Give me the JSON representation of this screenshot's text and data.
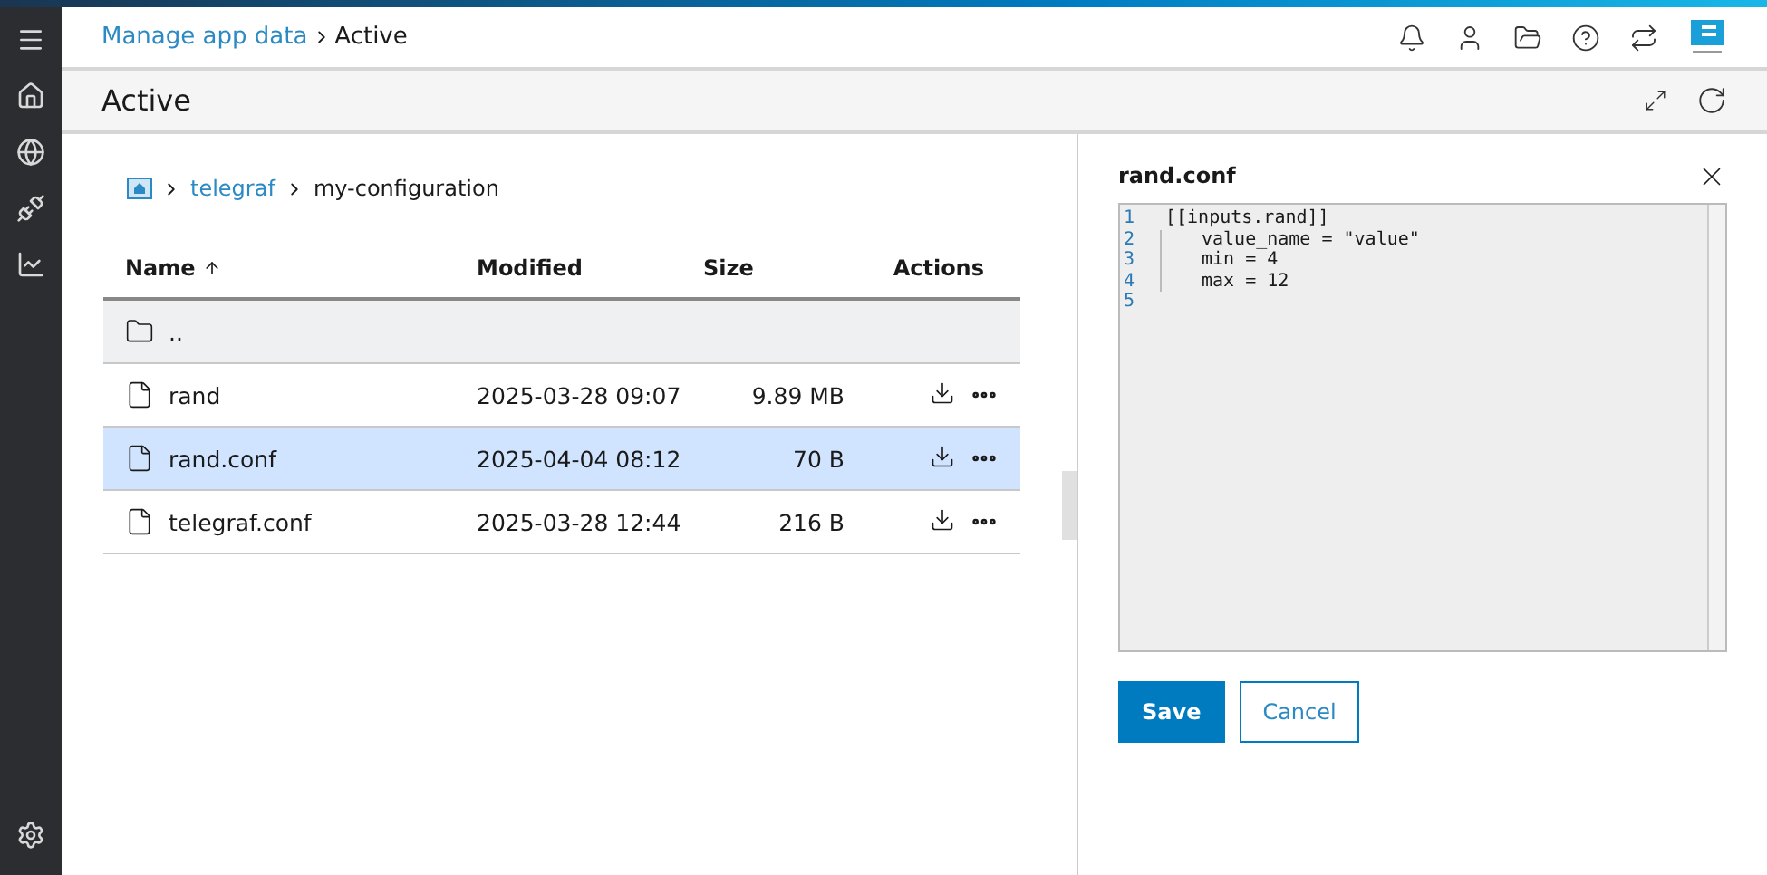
{
  "breadcrumb": [
    {
      "label": "Manage app data",
      "link": true
    },
    {
      "label": "Active",
      "link": false
    }
  ],
  "page_title": "Active",
  "path": [
    {
      "label": "telegraf",
      "link": true
    },
    {
      "label": "my-configuration",
      "link": false
    }
  ],
  "table": {
    "columns": [
      {
        "label": "Name",
        "sorted": true
      },
      {
        "label": "Modified",
        "sorted": false
      },
      {
        "label": "Size",
        "sorted": false
      },
      {
        "label": "Actions",
        "sorted": false
      }
    ],
    "rows": [
      {
        "kind": "parent",
        "name": "..",
        "selected": false
      },
      {
        "kind": "file",
        "name": "rand",
        "modified": "2025-03-28 09:07",
        "size": "9.89 MB",
        "selected": false
      },
      {
        "kind": "file",
        "name": "rand.conf",
        "modified": "2025-04-04 08:12",
        "size": "70 B",
        "selected": true
      },
      {
        "kind": "file",
        "name": "telegraf.conf",
        "modified": "2025-03-28 12:44",
        "size": "216 B",
        "selected": false
      }
    ]
  },
  "editor": {
    "title": "rand.conf",
    "lines": [
      {
        "number": "1",
        "text": "[[inputs.rand]]",
        "indented": false
      },
      {
        "number": "2",
        "text": "value_name = \"value\"",
        "indented": true
      },
      {
        "number": "3",
        "text": "min = 4",
        "indented": true
      },
      {
        "number": "4",
        "text": "max = 12",
        "indented": true
      },
      {
        "number": "5",
        "indented": false
      }
    ],
    "buttons": [
      {
        "label": "Save",
        "kind": "primary"
      },
      {
        "label": "Cancel",
        "kind": "secondary"
      }
    ]
  }
}
